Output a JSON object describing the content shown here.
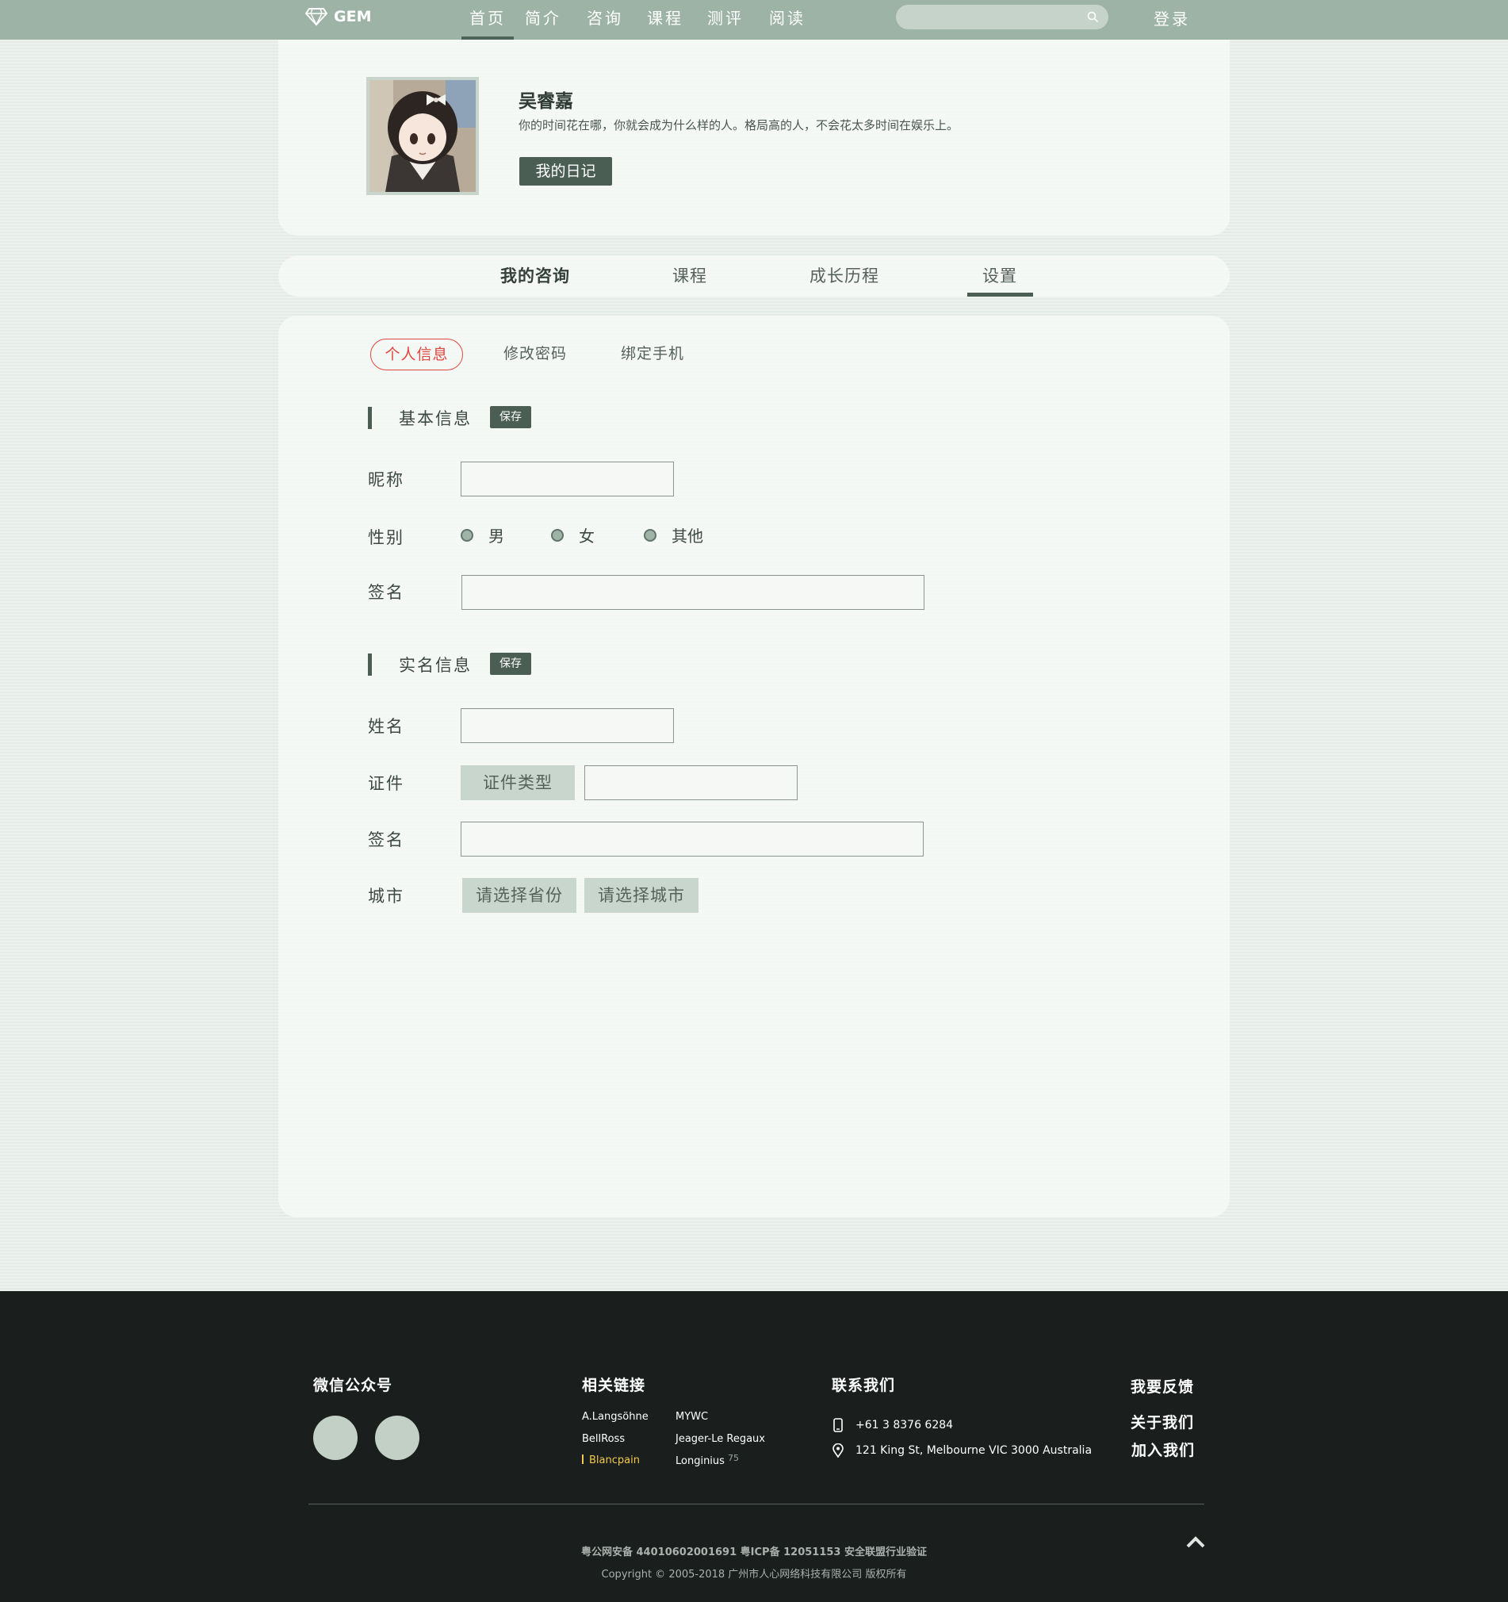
{
  "header": {
    "logo_text": "GEM",
    "nav": [
      "首页",
      "简介",
      "咨询",
      "课程",
      "测评",
      "阅读"
    ],
    "active_nav": "首页",
    "search_placeholder": "",
    "login_label": "登录"
  },
  "profile": {
    "name": "吴睿嘉",
    "motto": "你的时间花在哪，你就会成为什么样的人。格局高的人，不会花太多时间在娱乐上。",
    "diary_button": "我的日记"
  },
  "tabs": [
    "我的咨询",
    "课程",
    "成长历程",
    "设置"
  ],
  "active_tab": "设置",
  "settings": {
    "subtabs": [
      "个人信息",
      "修改密码",
      "绑定手机"
    ],
    "active_subtab": "个人信息",
    "basic": {
      "title": "基本信息",
      "save_label": "保存",
      "nickname_label": "昵称",
      "nickname_value": "",
      "gender_label": "性别",
      "gender_options": [
        "男",
        "女",
        "其他"
      ],
      "signature_label": "签名",
      "signature_value": ""
    },
    "realname": {
      "title": "实名信息",
      "save_label": "保存",
      "name_label": "姓名",
      "name_value": "",
      "id_label": "证件",
      "id_type_button": "证件类型",
      "id_value": "",
      "signature_label": "签名",
      "signature_value": "",
      "city_label": "城市",
      "province_select": "请选择省份",
      "city_select": "请选择城市"
    }
  },
  "footer": {
    "wechat_title": "微信公众号",
    "links_title": "相关链接",
    "links_col1": [
      "A.Langsöhne",
      "BellRoss",
      "Blancpain"
    ],
    "links_col2": [
      "MYWC",
      "Jeager-Le Regaux",
      "Longinius"
    ],
    "links_badge": "75",
    "highlighted_link": "Blancpain",
    "contact_title": "联系我们",
    "phone": "+61 3 8376 6284",
    "address": "121 King St, Melbourne VIC 3000 Australia",
    "feedback": "我要反馈",
    "about": "关于我们",
    "join": "加入我们",
    "icp_line": "粤公网安备 44010602001691  粤ICP备 12051153  安全联盟行业验证",
    "copyright": "Copyright © 2005-2018 广州市人心网络科技有限公司 版权所有"
  },
  "colors": {
    "header_bg": "#9db3a5",
    "accent": "#4b5e54",
    "active_subtab": "#e0473f",
    "footer_bg": "#1a1f1e",
    "link_highlight": "#f2c94c"
  }
}
